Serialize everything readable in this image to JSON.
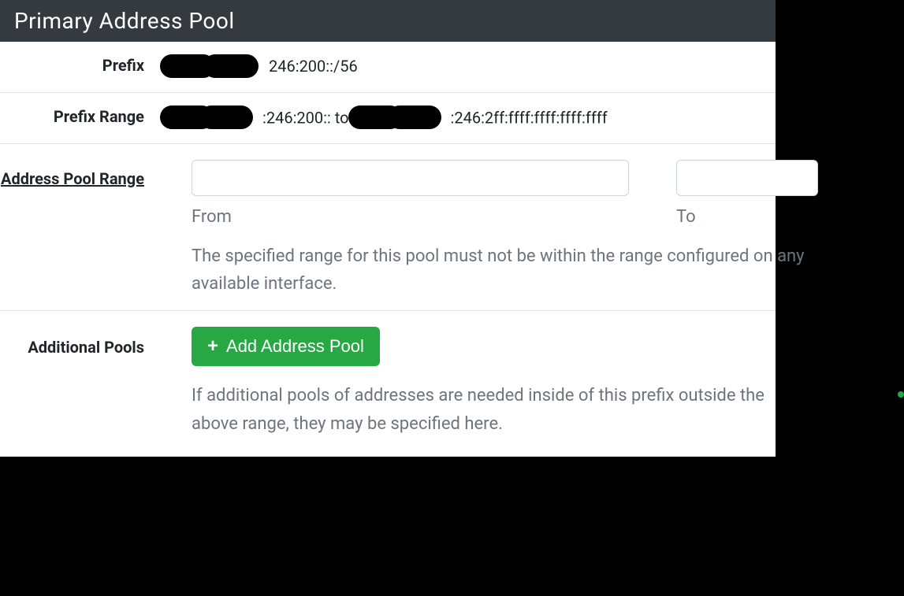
{
  "panel": {
    "title": "Primary Address Pool"
  },
  "prefix": {
    "label": "Prefix",
    "value_suffix": "246:200::/56"
  },
  "prefix_range": {
    "label": "Prefix Range",
    "start_suffix": ":246:200:: to",
    "end_suffix": ":246:2ff:ffff:ffff:ffff:ffff"
  },
  "address_pool_range": {
    "label": "Address Pool Range",
    "from_label": "From",
    "to_label": "To",
    "from_value": "",
    "to_value": "",
    "help": "The specified range for this pool must not be within the range configured on any available interface."
  },
  "additional_pools": {
    "label": "Additional Pools",
    "button_label": "Add Address Pool",
    "help": "If additional pools of addresses are needed inside of this prefix outside the above range, they may be specified here."
  }
}
